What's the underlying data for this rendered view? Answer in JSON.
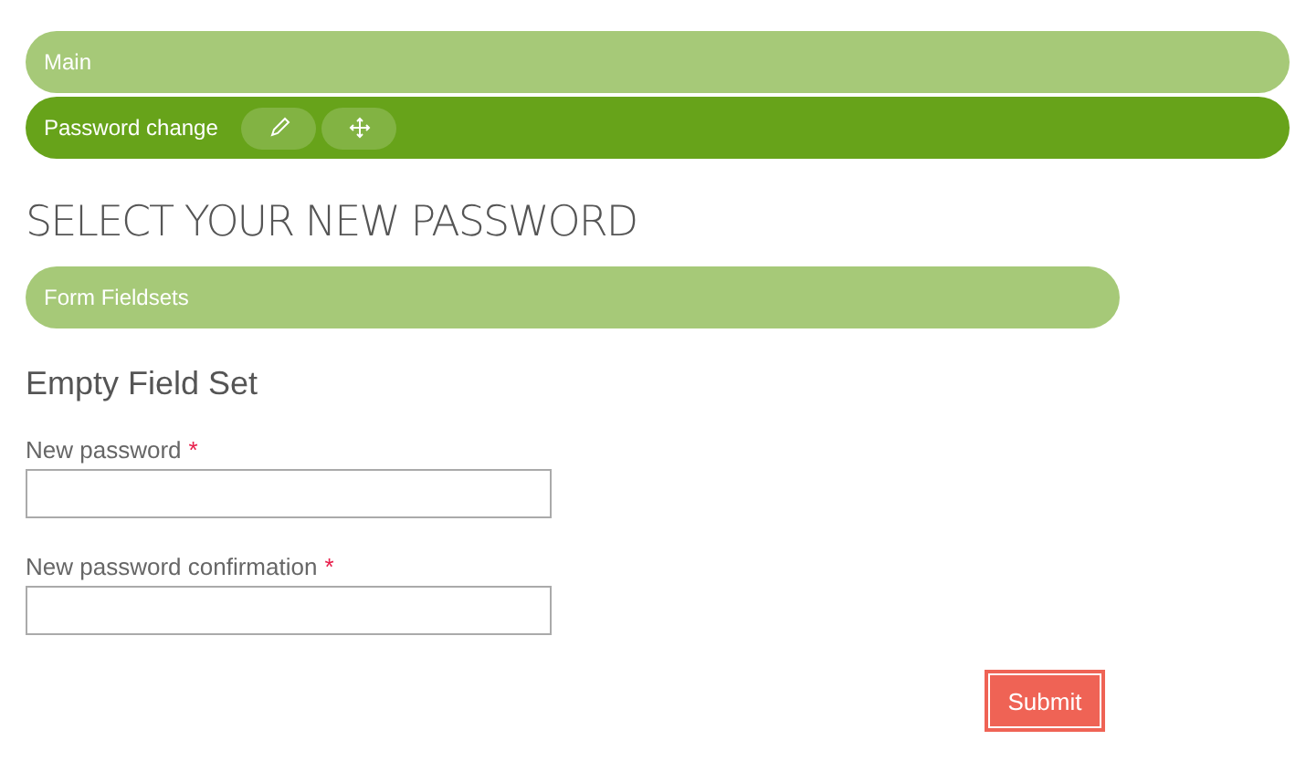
{
  "bars": [
    {
      "label": "Main",
      "kind": "plain"
    },
    {
      "label": "Password change",
      "kind": "tools"
    }
  ],
  "heading": "SELECT YOUR NEW PASSWORD",
  "section_bar": "Form Fieldsets",
  "fieldset_title": "Empty Field Set",
  "fields": [
    {
      "label": "New password",
      "required_mark": "*"
    },
    {
      "label": "New password confirmation",
      "required_mark": "*"
    }
  ],
  "submit": "Submit"
}
